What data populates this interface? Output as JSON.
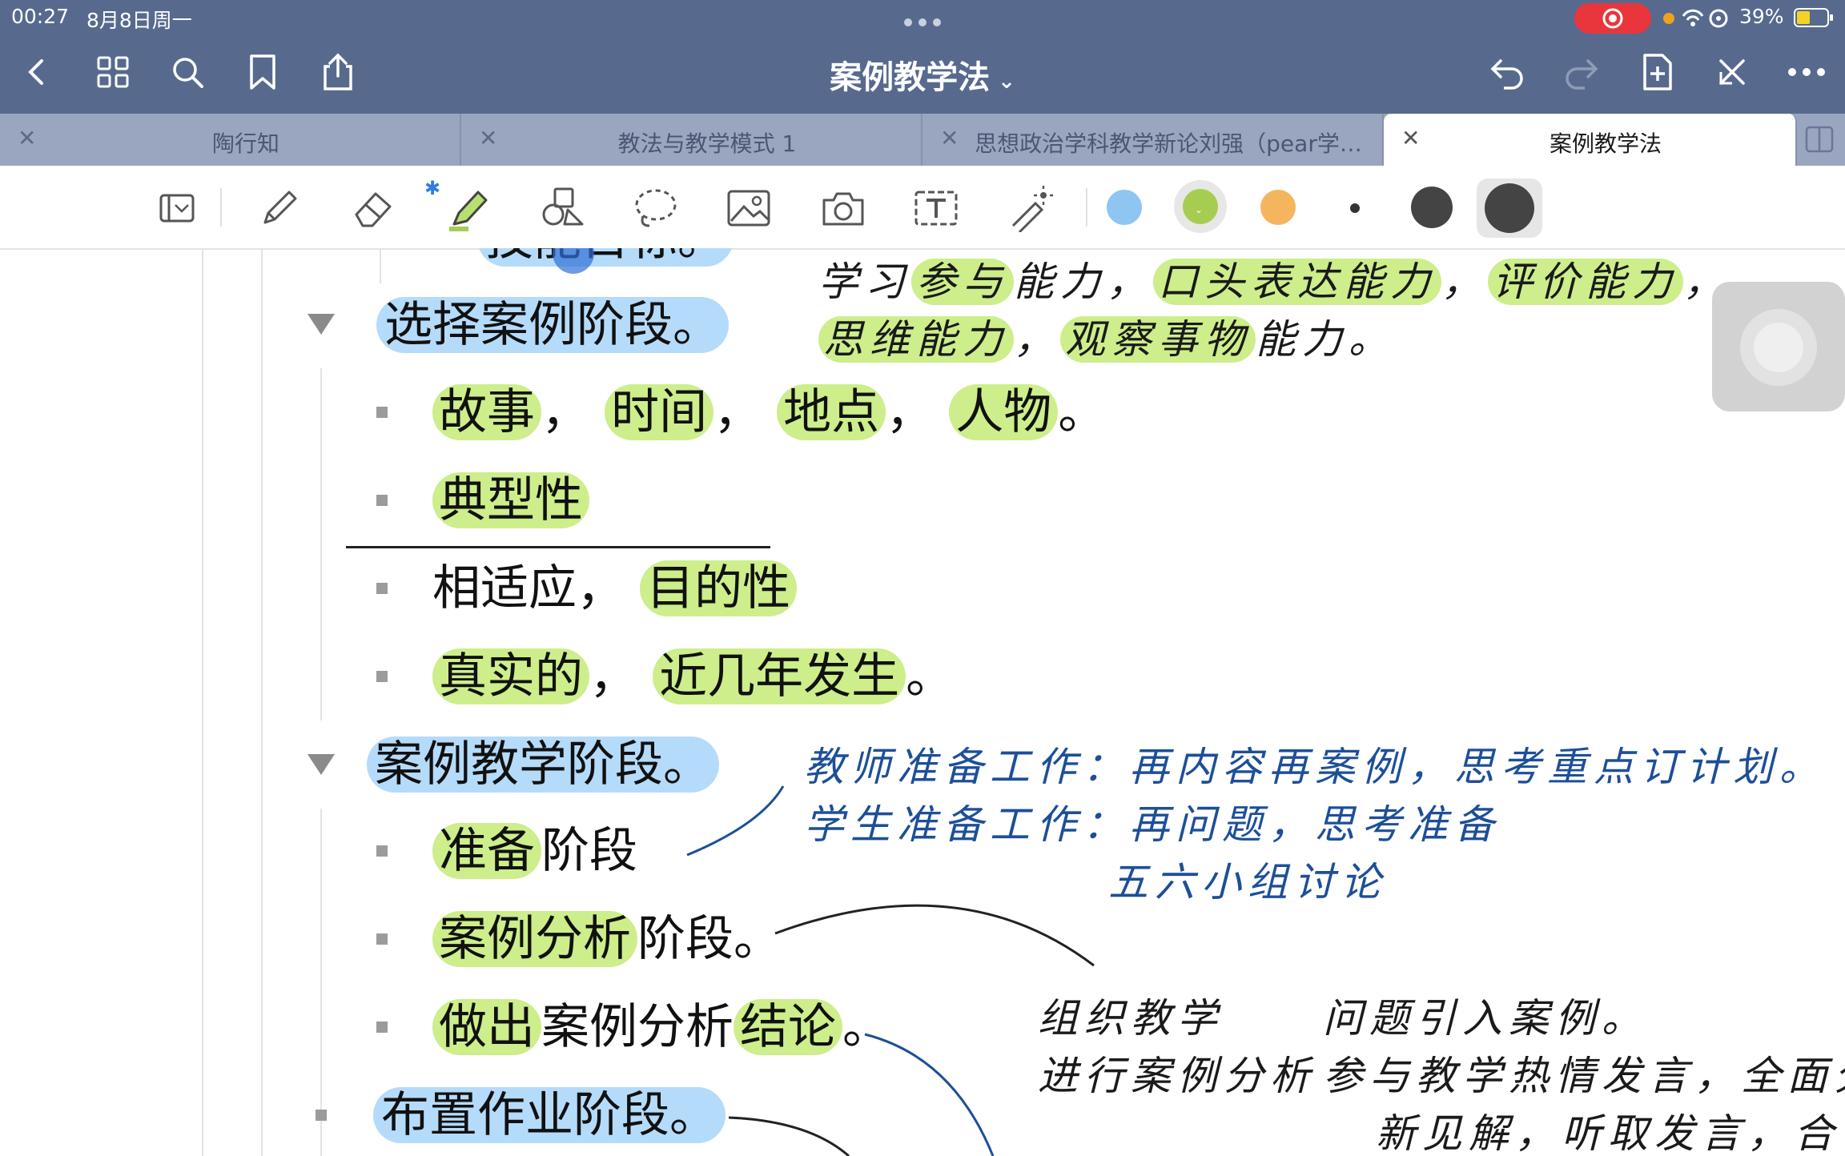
{
  "status": {
    "time": "00:27",
    "date": "8月8日周一",
    "battery": "39%"
  },
  "nav": {
    "title": "案例教学法",
    "icons": [
      "back-icon",
      "grid-icon",
      "search-icon",
      "bookmark-icon",
      "share-icon",
      "undo-icon",
      "redo-icon",
      "add-page-icon",
      "close-fullscreen-icon",
      "more-icon"
    ]
  },
  "tabs": [
    {
      "label": "陶行知",
      "active": false
    },
    {
      "label": "教法与教学模式 1",
      "active": false
    },
    {
      "label": "思想政治学科教学新论刘强（pear学…",
      "active": false
    },
    {
      "label": "案例教学法",
      "active": true
    }
  ],
  "toolbar": {
    "tools": [
      "reader-icon",
      "pen-icon",
      "eraser-icon",
      "highlighter-icon",
      "shapes-icon",
      "lasso-icon",
      "image-icon",
      "camera-icon",
      "text-icon",
      "laser-pointer-icon"
    ],
    "colors": [
      "#8ec5f2",
      "#a6cd52",
      "#f5b55e"
    ],
    "stroke_colors": [
      "#444444",
      "#444444"
    ]
  },
  "outline": {
    "cut_line": "技能目标。",
    "section1": "选择案例阶段。",
    "s1_items": [
      [
        "故事",
        "，",
        "时间",
        "，",
        "地点",
        "，",
        "人物",
        "。"
      ],
      [
        "典型性"
      ],
      [
        "相适应",
        "，",
        "目的性"
      ],
      [
        "真实的",
        "，",
        "近几年发生",
        "。"
      ]
    ],
    "section2": "案例教学阶段。",
    "s2_item1": [
      "准备",
      "阶段"
    ],
    "s2_item2": [
      "案例分析",
      "阶段。"
    ],
    "s2_item3": [
      "做出",
      "案例分析",
      "结论",
      "。"
    ],
    "section3": "布置作业阶段。"
  },
  "handwriting": {
    "l1": [
      "学习",
      "参与",
      "能力，",
      "口头表达能力",
      "，",
      "评价能力",
      "，"
    ],
    "l2": [
      "思维能力",
      "，",
      "观察事物",
      "能力。"
    ],
    "teacher": "教师准备工作：再内容再案例，思考重点订计划。",
    "student": "学生准备工作：再问题，思考准备",
    "group": "五六小组讨论",
    "org": "组织教学",
    "question": "问题引入案例。",
    "analysis": "进行案例分析",
    "participate": "参与教学热情发言，全面分析",
    "newview": "新见解，听取发言，合作"
  }
}
